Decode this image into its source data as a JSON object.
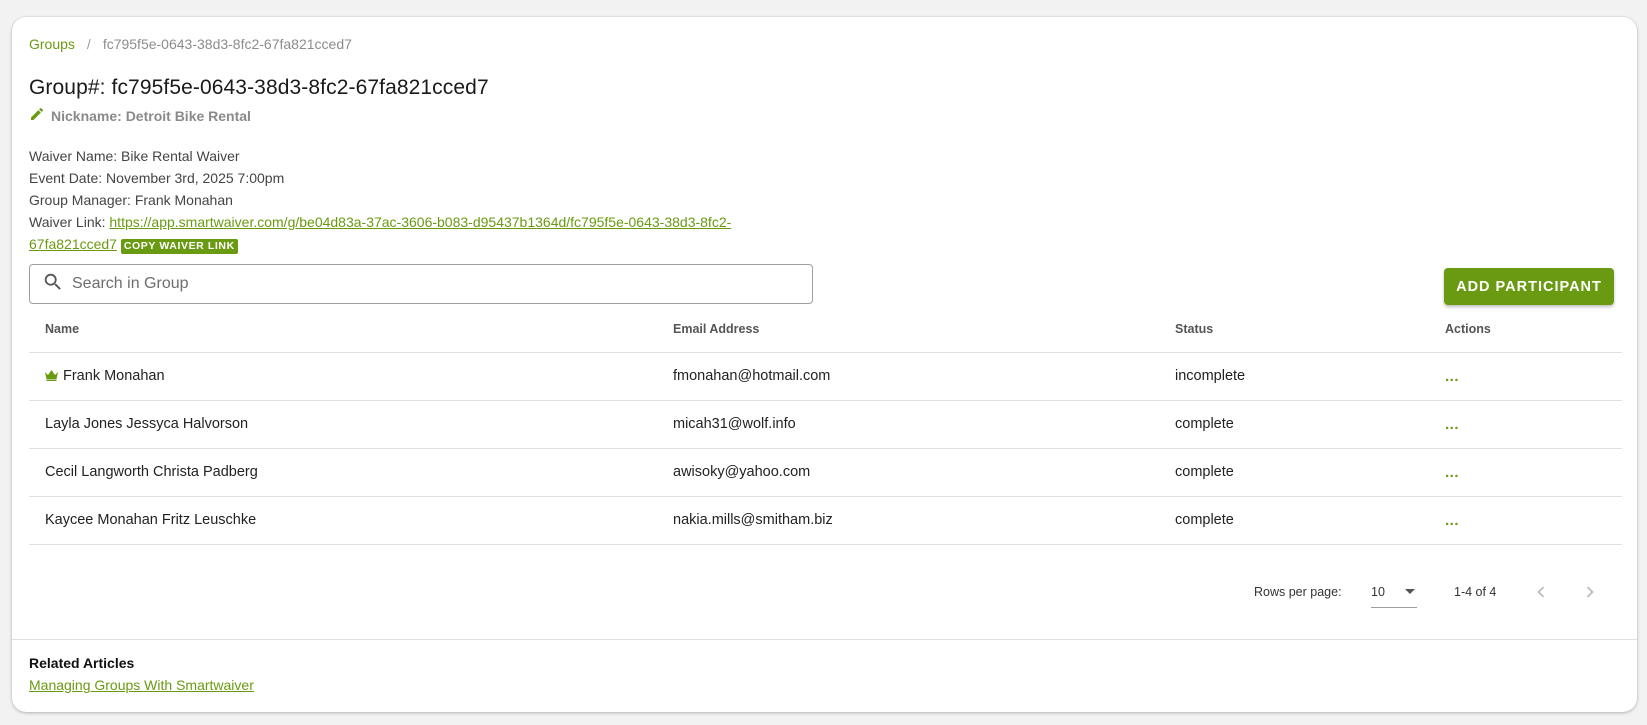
{
  "breadcrumb": {
    "root": "Groups",
    "separator": "/",
    "current": "fc795f5e-0643-38d3-8fc2-67fa821cced7"
  },
  "group": {
    "title": "Group#: fc795f5e-0643-38d3-8fc2-67fa821cced7",
    "nickname": "Nickname: Detroit Bike Rental",
    "waiver_name": "Waiver Name: Bike Rental Waiver",
    "event_date": "Event Date: November 3rd, 2025 7:00pm",
    "manager": "Group Manager: Frank Monahan",
    "waiver_link_label": "Waiver Link: ",
    "waiver_link_url": "https://app.smartwaiver.com/g/be04d83a-37ac-3606-b083-d95437b1364d/fc795f5e-0643-38d3-8fc2-67fa821cced7",
    "copy_button": "COPY WAIVER LINK"
  },
  "search": {
    "placeholder": "Search in Group",
    "value": ""
  },
  "add_participant_button": "ADD PARTICIPANT",
  "table": {
    "headers": {
      "name": "Name",
      "email": "Email Address",
      "status": "Status",
      "actions": "Actions"
    },
    "rows": [
      {
        "name": "Frank Monahan",
        "email": "fmonahan@hotmail.com",
        "status": "incomplete",
        "actions": "...",
        "manager_icon": "crown-icon"
      },
      {
        "name": "Layla Jones Jessyca Halvorson",
        "email": "micah31@wolf.info",
        "status": "complete",
        "actions": "..."
      },
      {
        "name": "Cecil Langworth Christa Padberg",
        "email": "awisoky@yahoo.com",
        "status": "complete",
        "actions": "..."
      },
      {
        "name": "Kaycee Monahan Fritz Leuschke",
        "email": "nakia.mills@smitham.biz",
        "status": "complete",
        "actions": "..."
      }
    ]
  },
  "pagination": {
    "rows_per_page_label": "Rows per page:",
    "rows_per_page": "10",
    "range": "1-4 of 4"
  },
  "related": {
    "title": "Related Articles",
    "link": "Managing Groups With Smartwaiver"
  },
  "colors": {
    "accent": "#6a9a12",
    "background": "#f2f2f2",
    "card": "#ffffff"
  }
}
